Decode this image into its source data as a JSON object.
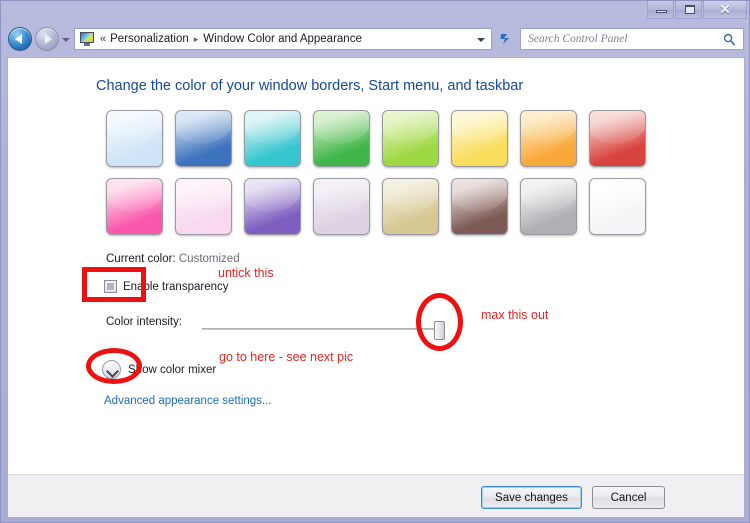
{
  "window": {
    "title_bar": {
      "minimize_label": "Minimize",
      "maximize_label": "Restore",
      "close_label": "Close",
      "close_glyph": "✕"
    },
    "frame_color": "#a9acd4"
  },
  "navbar": {
    "back_label": "Back",
    "forward_label": "Forward",
    "history_dropdown_label": "Recent pages",
    "address_icon": "personalization-monitor-icon",
    "address_prefix": "«",
    "breadcrumbs": [
      {
        "label": "Personalization"
      },
      {
        "label": "Window Color and Appearance"
      }
    ],
    "breadcrumb_separator": "▸",
    "address_caret": "▾",
    "refresh_glyph": "↻",
    "search": {
      "placeholder": "Search Control Panel",
      "value": "",
      "icon": "search-magnifier-icon"
    }
  },
  "main": {
    "page_title": "Change the color of your window borders, Start menu, and taskbar",
    "swatches": [
      {
        "name": "sky",
        "top": "#eef6fd",
        "bottom": "#cfe4f7"
      },
      {
        "name": "blue",
        "top": "#c5d8ef",
        "bottom": "#3d72bd"
      },
      {
        "name": "teal",
        "top": "#cdf0f1",
        "bottom": "#36c6cf"
      },
      {
        "name": "green",
        "top": "#c7e9b9",
        "bottom": "#3fb54a"
      },
      {
        "name": "lime",
        "top": "#dcf0ae",
        "bottom": "#9ed842"
      },
      {
        "name": "yellow",
        "top": "#fdf4c4",
        "bottom": "#f9dd5c"
      },
      {
        "name": "orange",
        "top": "#fde3b4",
        "bottom": "#f9a93a"
      },
      {
        "name": "red",
        "top": "#f3c9c4",
        "bottom": "#d9433f"
      },
      {
        "name": "pink",
        "top": "#fdd3e7",
        "bottom": "#fa58ac"
      },
      {
        "name": "pale-pink",
        "top": "#fdeef8",
        "bottom": "#f8d9ef"
      },
      {
        "name": "purple",
        "top": "#ded3ee",
        "bottom": "#7e5fc0"
      },
      {
        "name": "lavender",
        "top": "#f0eaf3",
        "bottom": "#ddd2e2"
      },
      {
        "name": "khaki",
        "top": "#efe9d2",
        "bottom": "#d7c893"
      },
      {
        "name": "brown",
        "top": "#ddcfcb",
        "bottom": "#7d5a56"
      },
      {
        "name": "gray",
        "top": "#ececee",
        "bottom": "#b0b0b4"
      },
      {
        "name": "white",
        "top": "#ffffff",
        "bottom": "#f4f4f6"
      }
    ],
    "current_color": {
      "label": "Current color:",
      "value": "Customized"
    },
    "transparency": {
      "label": "Enable transparency",
      "checked": true
    },
    "intensity": {
      "label": "Color intensity:",
      "value": 100,
      "min": 0,
      "max": 100
    },
    "color_mixer": {
      "label": "Show color mixer",
      "toggle_icon": "chevron-down-icon",
      "expanded": false
    },
    "advanced_link": "Advanced appearance settings..."
  },
  "footer": {
    "save_label": "Save changes",
    "cancel_label": "Cancel"
  },
  "annotations": {
    "color": "#ee1111",
    "untick": "untick this",
    "max_out": "max this out",
    "go_to_here": "go to here - see next pic"
  }
}
